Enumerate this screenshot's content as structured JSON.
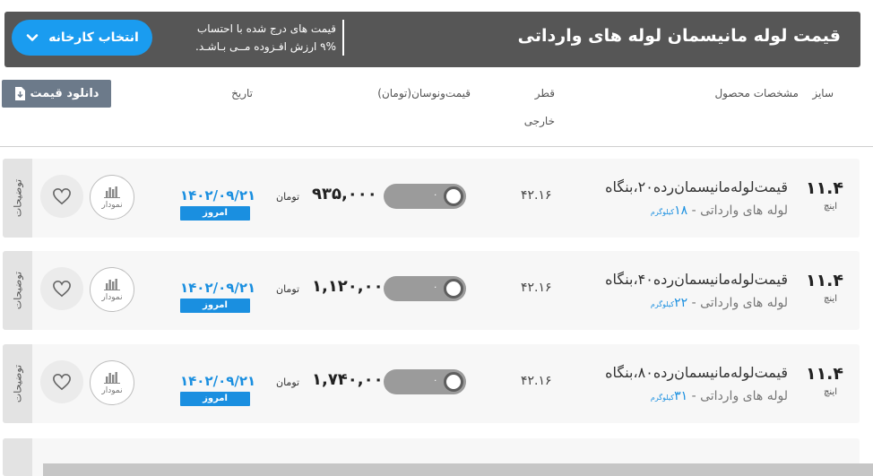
{
  "header": {
    "title": "قیمت لوله مانیسمان لوله های وارداتی",
    "note_line1": "قیمت های درج شده با احتساب",
    "note_line2": "۹% ارزش افـزوده مــی بـاشـد.",
    "factory_button_label": "انتخاب کارخانه"
  },
  "columns": {
    "size": "سایز",
    "specs": "مشخصات محصول",
    "diameter_line1": "قطر",
    "diameter_line2": "خارجی",
    "price_change": "قیمت‌ونوسان(تومان)",
    "date": "تاریخ"
  },
  "download_button_label": "دانلود قیمت",
  "row_labels": {
    "description_tab": "توضیحات",
    "chart_button": "نمودار",
    "today_badge": "امروز",
    "currency": "تومان",
    "size_unit": "اینچ",
    "weight_unit": "کیلوگرم",
    "toggle_value": "۰"
  },
  "rows": [
    {
      "size": "۱۱.۴",
      "name": "قیمت‌لوله‌مانیسمان‌رده‌۲۰،بنگاه",
      "origin": "لوله های وارداتی",
      "weight": "۱۸",
      "diameter": "۴۲.۱۶",
      "price": "۹۳۵,۰۰۰",
      "date": "۱۴۰۲/۰۹/۲۱"
    },
    {
      "size": "۱۱.۴",
      "name": "قیمت‌لوله‌مانیسمان‌رده‌۴۰،بنگاه",
      "origin": "لوله های وارداتی",
      "weight": "۲۲",
      "diameter": "۴۲.۱۶",
      "price": "۱,۱۲۰,۰۰۰",
      "date": "۱۴۰۲/۰۹/۲۱"
    },
    {
      "size": "۱۱.۴",
      "name": "قیمت‌لوله‌مانیسمان‌رده‌۸۰،بنگاه",
      "origin": "لوله های وارداتی",
      "weight": "۳۱",
      "diameter": "۴۲.۱۶",
      "price": "۱,۷۴۰,۰۰۰",
      "date": "۱۴۰۲/۰۹/۲۱"
    }
  ]
}
